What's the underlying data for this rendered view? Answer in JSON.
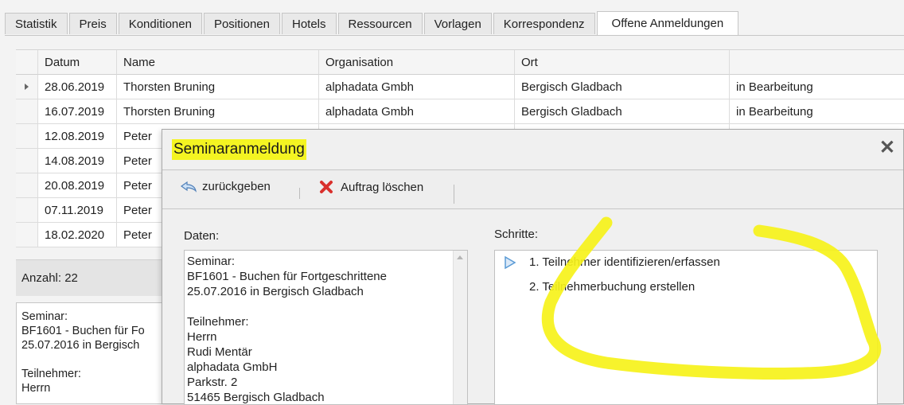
{
  "tabs": [
    "Statistik",
    "Preis",
    "Konditionen",
    "Positionen",
    "Hotels",
    "Ressourcen",
    "Vorlagen",
    "Korrespondenz",
    "Offene Anmeldungen"
  ],
  "grid": {
    "headers": [
      "Datum",
      "Name",
      "Organisation",
      "Ort",
      ""
    ],
    "rows": [
      [
        "28.06.2019",
        "Thorsten Bruning",
        "alphadata Gmbh",
        "Bergisch Gladbach",
        "in Bearbeitung"
      ],
      [
        "16.07.2019",
        "Thorsten Bruning",
        "alphadata Gmbh",
        "Bergisch Gladbach",
        "in Bearbeitung"
      ],
      [
        "12.08.2019",
        "Peter",
        "",
        "",
        ""
      ],
      [
        "14.08.2019",
        "Peter",
        "",
        "",
        ""
      ],
      [
        "20.08.2019",
        "Peter",
        "",
        "",
        ""
      ],
      [
        "07.11.2019",
        "Peter",
        "",
        "",
        ""
      ],
      [
        "18.02.2020",
        "Peter",
        "",
        "",
        ""
      ]
    ],
    "count_label": "Anzahl: 22"
  },
  "detail_lines": [
    "Seminar:",
    "BF1601 - Buchen für Fo",
    "25.07.2016 in Bergisch",
    "",
    "Teilnehmer:",
    "Herrn"
  ],
  "dialog": {
    "title": "Seminaranmeldung",
    "close_glyph": "✕",
    "toolbar": {
      "back_label": "zurückgeben",
      "delete_label": "Auftrag löschen"
    },
    "data_label": "Daten:",
    "steps_label": "Schritte:",
    "data_lines": [
      "Seminar:",
      "BF1601 - Buchen für Fortgeschrittene",
      "25.07.2016 in Bergisch Gladbach",
      "",
      "Teilnehmer:",
      "Herrn",
      "Rudi Mentär",
      "alphadata GmbH",
      "Parkstr. 2",
      "51465 Bergisch Gladbach"
    ],
    "steps": [
      "1. Teilnehmer identifizieren/erfassen",
      "2. Teilnehmerbuchung erstellen"
    ]
  },
  "colors": {
    "highlight": "#f4f422",
    "annotation": "#f6f21a",
    "play_icon": "#5b9bd5",
    "delete_icon": "#d9302c"
  }
}
